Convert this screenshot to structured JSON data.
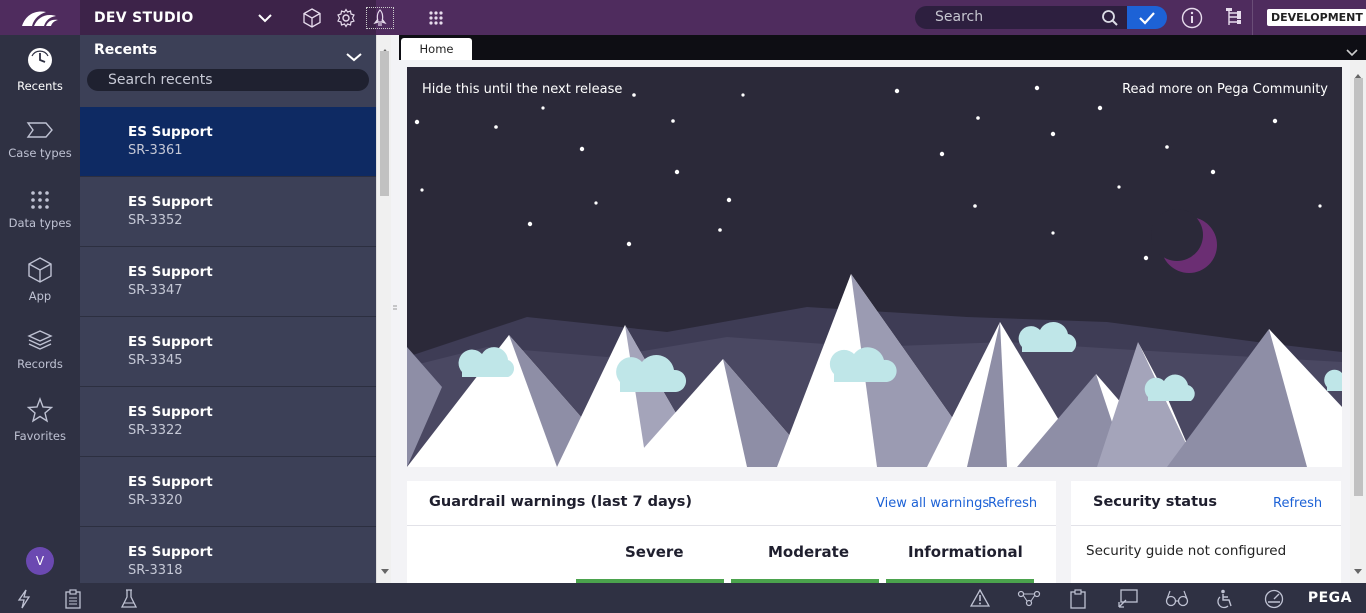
{
  "topbar": {
    "studio_title": "DEV STUDIO",
    "search_placeholder": "Search",
    "environment": "DEVELOPMENT"
  },
  "rail": {
    "items": [
      {
        "label": "Recents",
        "icon": "clock-icon"
      },
      {
        "label": "Case types",
        "icon": "case-type-icon"
      },
      {
        "label": "Data types",
        "icon": "grid-dots-icon"
      },
      {
        "label": "App",
        "icon": "cube-icon"
      },
      {
        "label": "Records",
        "icon": "layers-icon"
      },
      {
        "label": "Favorites",
        "icon": "star-icon"
      }
    ],
    "avatar_initial": "V"
  },
  "recents": {
    "title": "Recents",
    "search_placeholder": "Search recents",
    "items": [
      {
        "title": "ES Support",
        "id": "SR-3361"
      },
      {
        "title": "ES Support",
        "id": "SR-3352"
      },
      {
        "title": "ES Support",
        "id": "SR-3347"
      },
      {
        "title": "ES Support",
        "id": "SR-3345"
      },
      {
        "title": "ES Support",
        "id": "SR-3322"
      },
      {
        "title": "ES Support",
        "id": "SR-3320"
      },
      {
        "title": "ES Support",
        "id": "SR-3318"
      }
    ]
  },
  "tabs": {
    "home": "Home"
  },
  "banner": {
    "hide_link": "Hide this until the next release",
    "read_more": "Read more on Pega Community"
  },
  "guardrail": {
    "title": "Guardrail warnings (last 7 days)",
    "view_all": "View all warnings",
    "refresh": "Refresh",
    "columns": [
      "Severe",
      "Moderate",
      "Informational"
    ]
  },
  "security": {
    "title": "Security status",
    "refresh": "Refresh",
    "message": "Security guide not configured"
  },
  "bottombar": {
    "brand": "PEGA"
  },
  "colors": {
    "header_purple": "#4f2c5e",
    "rail_bg": "#2f3143",
    "panel_bg": "#3c4057",
    "active_item": "#0e2a63",
    "link_blue": "#1d62d6",
    "night_sky": "#2b2939",
    "moon": "#6b2e73",
    "cloud": "#bfe6e8",
    "success_green": "#4ba34d"
  }
}
